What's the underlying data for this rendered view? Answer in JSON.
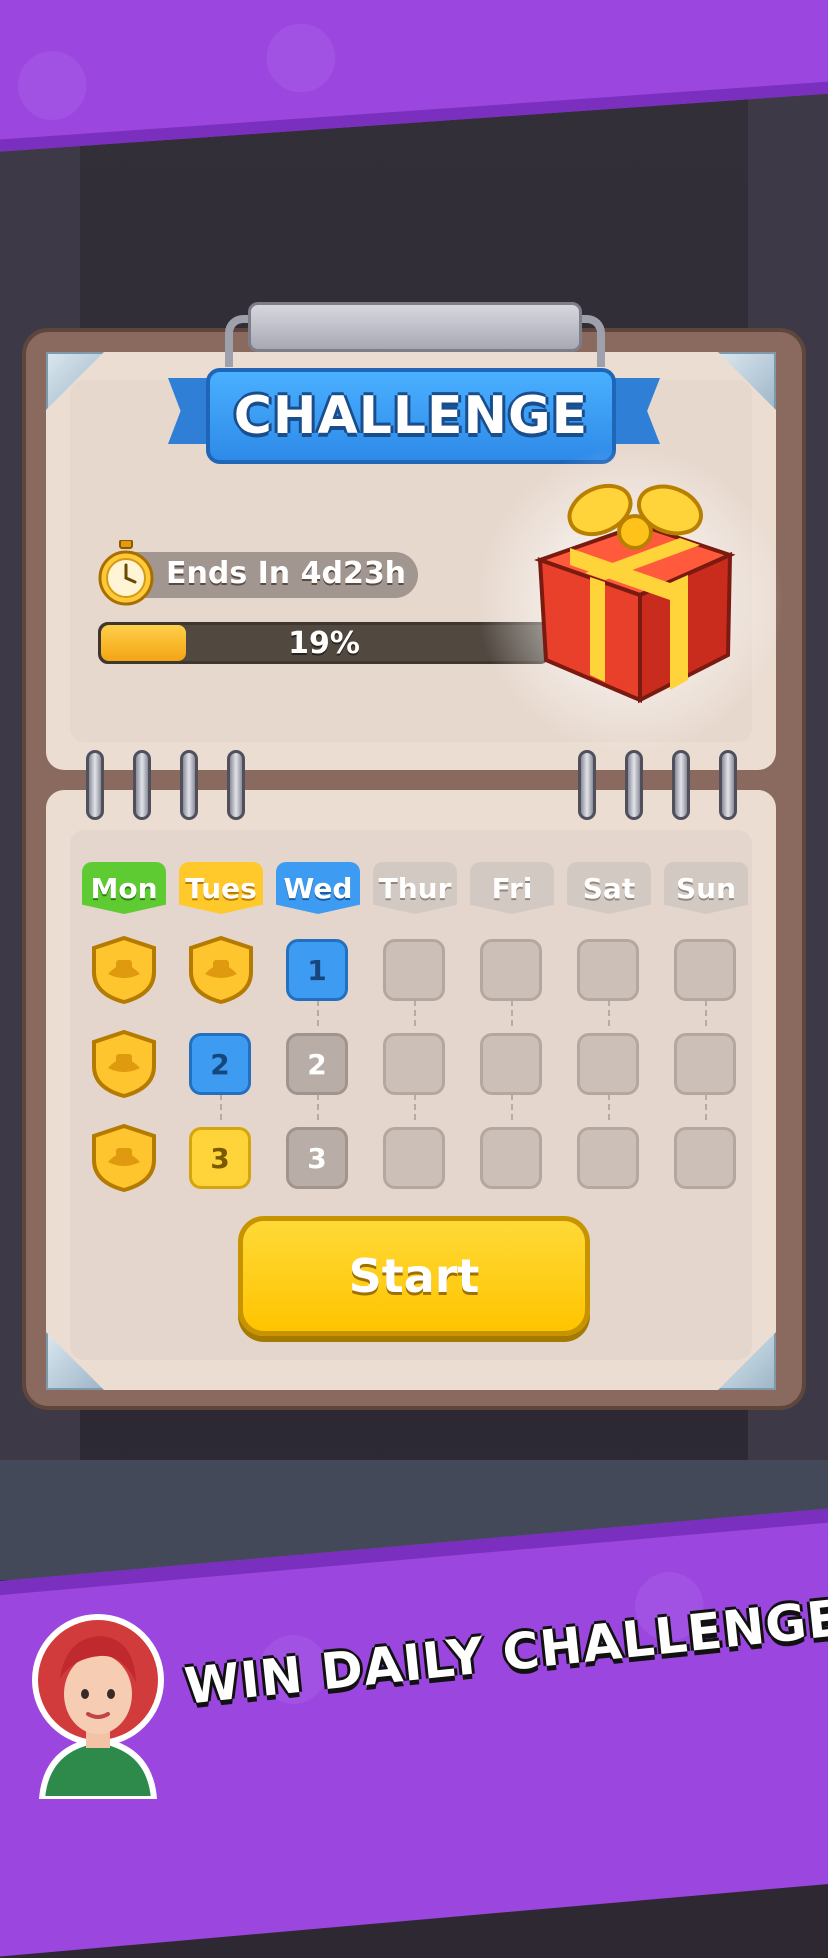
{
  "header": {
    "title": "CHALLENGE"
  },
  "timer": {
    "label": "Ends In 4d23h",
    "icon": "stopwatch-icon"
  },
  "progress": {
    "percent": 19,
    "label": "19%"
  },
  "reward": {
    "icon": "gift-box-icon"
  },
  "calendar": {
    "days": [
      "Mon",
      "Tues",
      "Wed",
      "Thur",
      "Fri",
      "Sat",
      "Sun"
    ],
    "levels": [
      [
        "badge",
        "badge",
        "1",
        "",
        "",
        "",
        ""
      ],
      [
        "badge",
        "2",
        "2",
        "",
        "",
        "",
        ""
      ],
      [
        "badge",
        "3",
        "3",
        "",
        "",
        "",
        ""
      ]
    ]
  },
  "start_button": {
    "label": "Start"
  },
  "promo": {
    "text": "WIN DAILY CHALLENGES"
  },
  "colors": {
    "purple_band": "#9b46df",
    "banner_blue": "#3d9bf2",
    "start_yellow": "#ffc400",
    "mon_green": "#5fcb32",
    "tues_yellow": "#ffc92c"
  }
}
